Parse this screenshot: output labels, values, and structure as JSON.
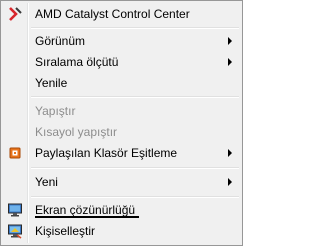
{
  "menu": {
    "items": [
      {
        "label": "AMD Catalyst Control Center",
        "icon": "amd-catalyst-icon"
      },
      {
        "label": "Görünüm",
        "submenu": true
      },
      {
        "label": "Sıralama ölçütü",
        "submenu": true
      },
      {
        "label": "Yenile"
      },
      {
        "label": "Yapıştır",
        "disabled": true
      },
      {
        "label": "Kısayol yapıştır",
        "disabled": true
      },
      {
        "label": "Paylaşılan Klasör Eşitleme",
        "submenu": true,
        "icon": "shared-folder-sync-icon"
      },
      {
        "label": "Yeni",
        "submenu": true
      },
      {
        "label": "Ekran çözünürlüğü",
        "icon": "screen-resolution-icon",
        "highlighted": true
      },
      {
        "label": "Kişiselleştir",
        "icon": "personalize-icon"
      }
    ]
  }
}
